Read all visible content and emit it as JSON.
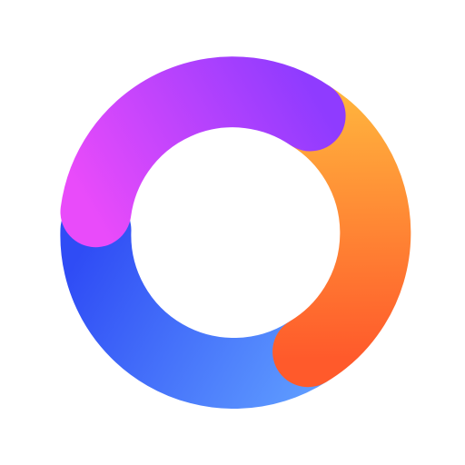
{
  "logo": {
    "icon": "gradient-ring-logo",
    "background_color": "#ffffff",
    "segments": [
      {
        "name": "purple",
        "from_color": "#8F3BFF",
        "to_color": "#E94BFA"
      },
      {
        "name": "orange",
        "from_color": "#FFB23D",
        "to_color": "#FF5A2B"
      },
      {
        "name": "blue",
        "from_color": "#2F4CF5",
        "to_color": "#5E9BFF"
      }
    ]
  }
}
